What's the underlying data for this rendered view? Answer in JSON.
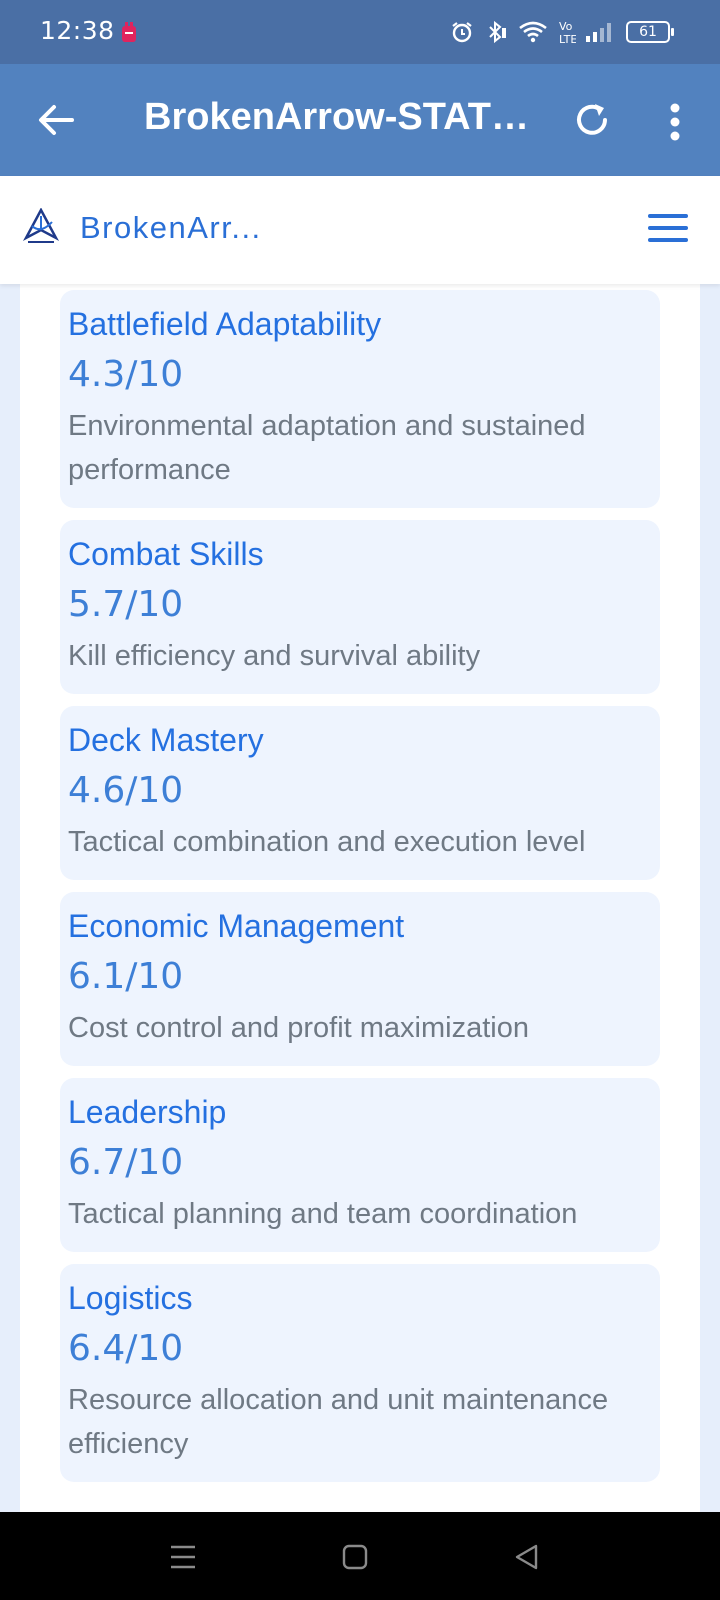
{
  "status_bar": {
    "time": "12:38",
    "battery": "61",
    "icons": [
      "alarm-icon",
      "bluetooth-icon",
      "wifi-icon",
      "volte-icon",
      "signal-icon",
      "battery-icon"
    ]
  },
  "app_bar": {
    "title": "BrokenArrow-STATS...",
    "back_icon": "arrow-left-icon",
    "refresh_icon": "refresh-icon",
    "more_icon": "more-vertical-icon"
  },
  "site_header": {
    "name": "BrokenArr...",
    "logo_icon": "brokenarrow-logo",
    "menu_icon": "hamburger-menu-icon"
  },
  "colors": {
    "status_bar": "#4a6fa5",
    "app_bar": "#5282bf",
    "accent": "#2470e0",
    "card_bg": "#eef4fe"
  },
  "stats": [
    {
      "title": "Battlefield Adaptability",
      "score": "4.3/10",
      "description": "Environmental adaptation and sustained performance"
    },
    {
      "title": "Combat Skills",
      "score": "5.7/10",
      "description": "Kill efficiency and survival ability"
    },
    {
      "title": "Deck Mastery",
      "score": "4.6/10",
      "description": "Tactical combination and execution level"
    },
    {
      "title": "Economic Management",
      "score": "6.1/10",
      "description": "Cost control and profit maximization"
    },
    {
      "title": "Leadership",
      "score": "6.7/10",
      "description": "Tactical planning and team coordination"
    },
    {
      "title": "Logistics",
      "score": "6.4/10",
      "description": "Resource allocation and unit maintenance efficiency"
    }
  ],
  "nav_bar": {
    "buttons": [
      "recents-icon",
      "home-icon",
      "back-triangle-icon"
    ]
  }
}
